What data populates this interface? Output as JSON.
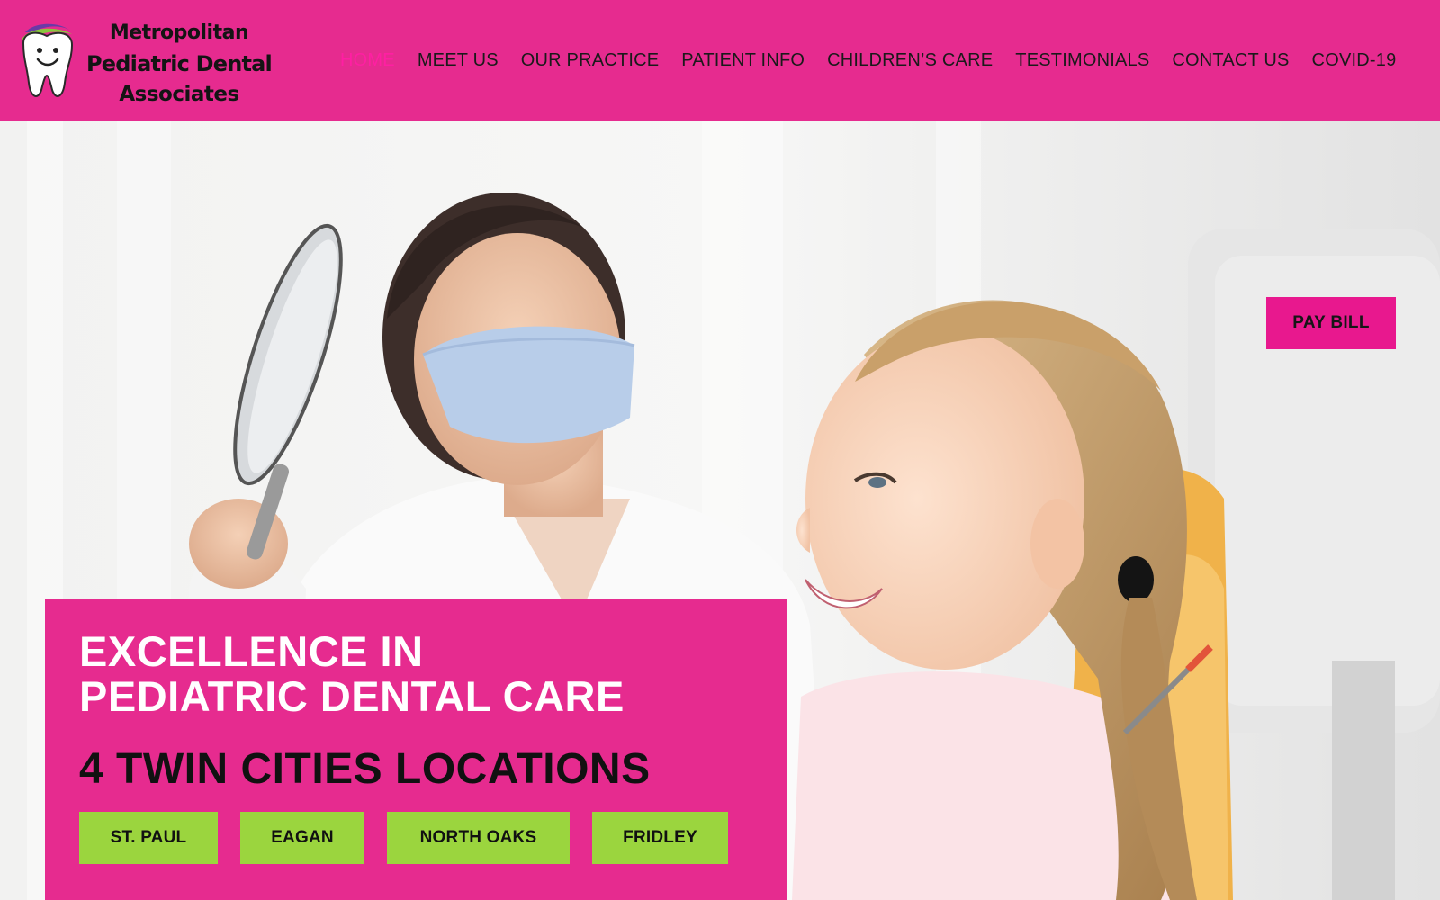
{
  "logo": {
    "line1": "Metropolitan",
    "line2": "Pediatric Dental",
    "line3": "Associates",
    "icon": "smiling-tooth-icon"
  },
  "nav": {
    "items": [
      {
        "label": "HOME",
        "active": true
      },
      {
        "label": "MEET US",
        "active": false
      },
      {
        "label": "OUR PRACTICE",
        "active": false
      },
      {
        "label": "PATIENT INFO",
        "active": false
      },
      {
        "label": "CHILDREN’S CARE",
        "active": false
      },
      {
        "label": "TESTIMONIALS",
        "active": false
      },
      {
        "label": "CONTACT US",
        "active": false
      },
      {
        "label": "COVID-19",
        "active": false
      }
    ]
  },
  "hero": {
    "pay_bill_label": "PAY BILL",
    "headline_line1": "EXCELLENCE IN",
    "headline_line2": "PEDIATRIC DENTAL CARE",
    "locations_title": "4 TWIN CITIES LOCATIONS",
    "locations": [
      "ST. PAUL",
      "EAGAN",
      "NORTH OAKS",
      "FRIDLEY"
    ]
  },
  "colors": {
    "brand_pink": "#e62b8f",
    "pay_bill_pink": "#e8188e",
    "active_nav": "#ff1fa3",
    "location_green": "#9bd53e",
    "text_dark": "#111111",
    "headline_white": "#ffffff"
  }
}
